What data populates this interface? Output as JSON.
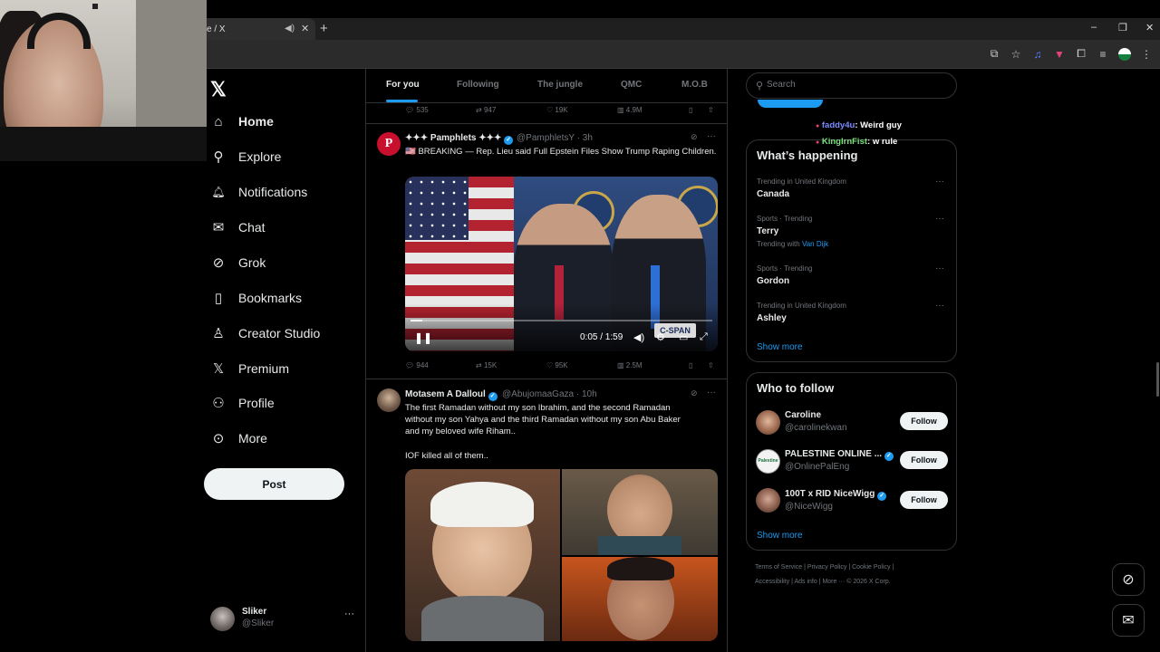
{
  "browser": {
    "tab_title": "e / X",
    "new_tab": "+",
    "window_controls": [
      "–",
      "❐",
      "✕"
    ],
    "toolbar_icons": [
      "cast-icon",
      "star-icon",
      "extension-icon",
      "extension-icon",
      "puzzle-icon",
      "media-icon",
      "profile-avatar",
      "menu-icon"
    ]
  },
  "nav": {
    "items": [
      {
        "label": "Home",
        "icon": "home-icon",
        "glyph": "⌂"
      },
      {
        "label": "Explore",
        "icon": "search-icon",
        "glyph": "⚲"
      },
      {
        "label": "Notifications",
        "icon": "bell-icon",
        "glyph": "🔔︎"
      },
      {
        "label": "Chat",
        "icon": "mail-icon",
        "glyph": "✉"
      },
      {
        "label": "Grok",
        "icon": "grok-icon",
        "glyph": "⊘"
      },
      {
        "label": "Bookmarks",
        "icon": "bookmark-icon",
        "glyph": "▯"
      },
      {
        "label": "Creator Studio",
        "icon": "creator-icon",
        "glyph": "♙"
      },
      {
        "label": "Premium",
        "icon": "x-icon",
        "glyph": "𝕏"
      },
      {
        "label": "Profile",
        "icon": "person-icon",
        "glyph": "⚇"
      },
      {
        "label": "More",
        "icon": "more-circle-icon",
        "glyph": "⊙"
      }
    ],
    "post_label": "Post",
    "account": {
      "name": "Sliker",
      "handle": "@Sliker",
      "more": "···"
    }
  },
  "feed": {
    "tabs": [
      "For you",
      "Following",
      "The jungle",
      "QMC",
      "M.O.B"
    ],
    "prev_actions": {
      "replies": "535",
      "reposts": "947",
      "likes": "19K",
      "views": "4.9M"
    },
    "tweet1": {
      "name": "✦✦✦ Pamphlets ✦✦✦",
      "handle": "@PamphletsY · 3h",
      "text": "🇺🇸 BREAKING — Rep. Lieu said Full Epstein Files Show Trump Raping Children.",
      "video_time": "0:05 / 1:59",
      "video_progress": 0.04,
      "cspan": "C-SPAN",
      "actions": {
        "replies": "944",
        "reposts": "15K",
        "likes": "95K",
        "views": "2.5M"
      }
    },
    "tweet2": {
      "name": "Motasem A Dalloul",
      "handle": "@AbujomaaGaza · 10h",
      "text_lines": [
        "The first Ramadan without my son Ibrahim, and the second Ramadan",
        "without my son Yahya and the third Ramadan without my son Abu Baker",
        "and my beloved wife Riham.."
      ],
      "text2": "IOF killed all of them.."
    }
  },
  "right": {
    "search_placeholder": "Search",
    "chat_overlay": [
      {
        "user": "faddy4u",
        "msg": ": Weird guy",
        "color": "#7b8cff"
      },
      {
        "user": "KingIrnFist",
        "msg": ": w rule",
        "color": "#7ee07e"
      }
    ],
    "whats_happening": {
      "title": "What’s happening",
      "trends": [
        {
          "meta": "Trending in United Kingdom",
          "name": "Canada"
        },
        {
          "meta": "Sports · Trending",
          "name": "Terry",
          "with_label": "Trending with",
          "with_link": "Van Dijk"
        },
        {
          "meta": "Sports · Trending",
          "name": "Gordon"
        },
        {
          "meta": "Trending in United Kingdom",
          "name": "Ashley"
        }
      ],
      "show_more": "Show more"
    },
    "who_to_follow": {
      "title": "Who to follow",
      "accounts": [
        {
          "name": "Caroline",
          "handle": "@carolinekwan",
          "button": "Follow"
        },
        {
          "name": "PALESTINE ONLINE ...",
          "handle": "@OnlinePalEng",
          "button": "Follow"
        },
        {
          "name": "100T x RID NiceWigg",
          "handle": "@NiceWigg",
          "button": "Follow"
        }
      ],
      "show_more": "Show more"
    },
    "footer_line1": "Terms of Service  |  Privacy Policy  |  Cookie Policy  |",
    "footer_line2": "Accessibility  |  Ads info  |  More ···  © 2026 X Corp."
  },
  "colors": {
    "accent": "#1d9bf0",
    "background": "#000000",
    "text": "#e7e9ea",
    "muted": "#71767b",
    "border": "#2f3336"
  }
}
